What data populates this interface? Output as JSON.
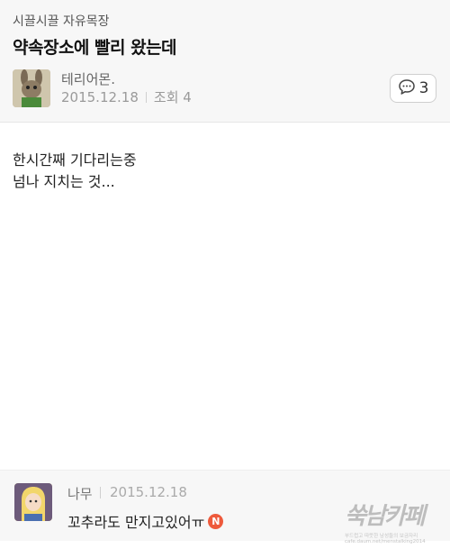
{
  "post": {
    "board": "시끌시끌 자유목장",
    "title": "약속장소에 빨리 왔는데",
    "author": "테리어몬.",
    "date": "2015.12.18",
    "views_label": "조회 4",
    "comment_count": "3",
    "body_lines": [
      "한시간째 기다리는중",
      "넘나 지치는 것..."
    ]
  },
  "comment": {
    "author": "나무",
    "date": "2015.12.18",
    "text": "꼬추라도 만지고있어ㅠ",
    "new_badge": "N"
  },
  "watermark": {
    "logo": "쑥남카페",
    "tagline": "부드럽고 따뜻한 남성들의 보금자리",
    "url": "cafe.daum.net/menstalking2014"
  },
  "colors": {
    "header_bg": "#f7f7f7",
    "new_badge": "#ee5a3c"
  }
}
